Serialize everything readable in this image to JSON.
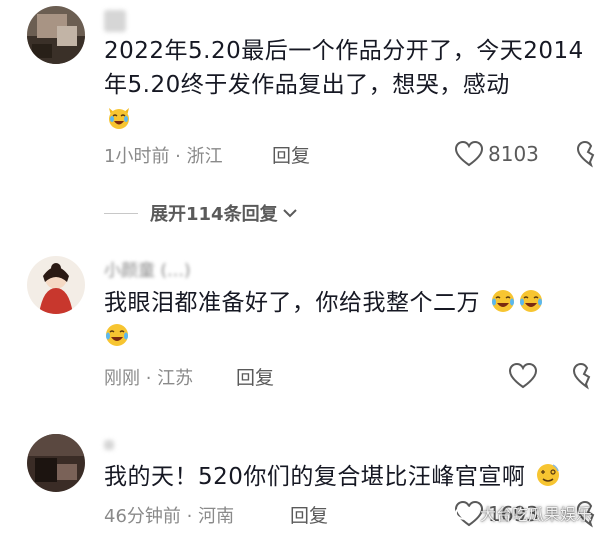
{
  "comments": [
    {
      "username": "",
      "text": "2022年5.20最后一个作品分开了，今天2014年5.20终于发作品复出了，想哭，感动",
      "emoji": "crying-laughing-cat-emoji",
      "meta": "1小时前 · 浙江",
      "reply_label": "回复",
      "likes": "8103"
    },
    {
      "username": "小颜童 (…) ",
      "text": "我眼泪都准备好了，你给我整个二万",
      "emoji": "crying-laughing-emoji",
      "meta": "刚刚 · 江苏",
      "reply_label": "回复",
      "likes": ""
    },
    {
      "username": "",
      "text": "我的天！520你们的复合堪比汪峰官宣啊",
      "emoji": "dizzy-face-emoji",
      "meta": "46分钟前 · 河南",
      "reply_label": "回复",
      "likes": "1693"
    }
  ],
  "expand_replies": {
    "label": "展开114条回复"
  },
  "watermark": {
    "text": "大台吃瓜果娱乐"
  },
  "colors": {
    "text": "#161823",
    "meta": "#8a8a8a",
    "icon": "#5a5a5a"
  }
}
